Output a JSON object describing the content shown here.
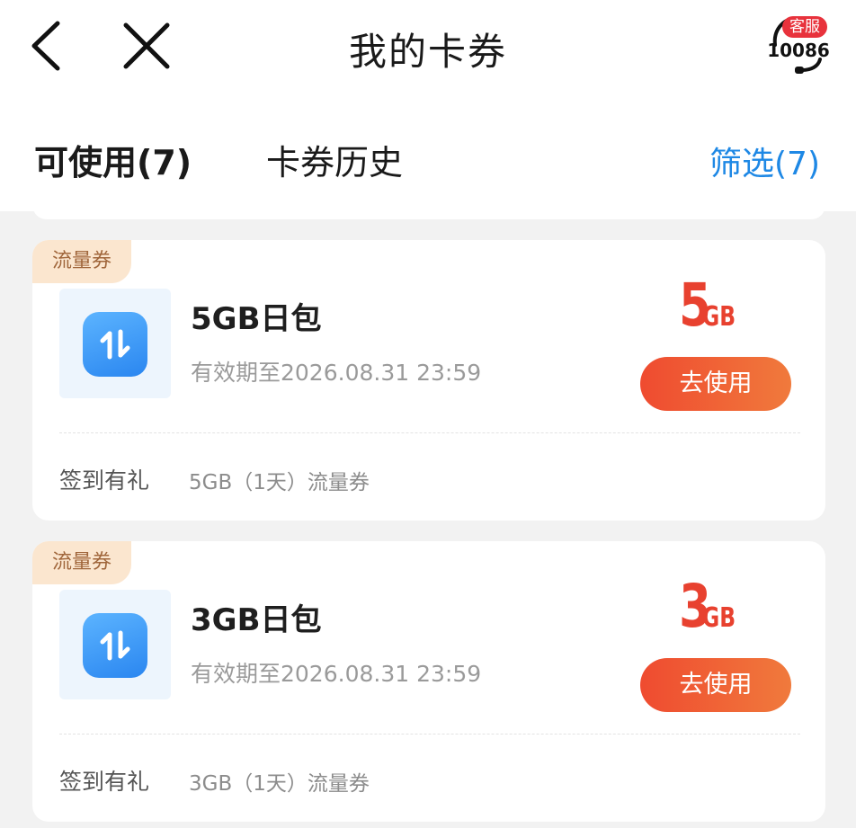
{
  "header": {
    "title": "我的卡券",
    "back_icon": "chevron-left-icon",
    "close_icon": "close-icon",
    "service": {
      "badge": "客服",
      "number": "10086",
      "icon": "headset-icon",
      "badge_color": "#e8323c"
    }
  },
  "tabs": {
    "available_label": "可使用(7)",
    "history_label": "卡券历史",
    "filter_label": "筛选(7)"
  },
  "colors": {
    "accent_blue": "#1e88e5",
    "amount_red": "#e8412f",
    "tag_bg": "#fbe6cf",
    "tag_text": "#a0663b"
  },
  "coupons": [
    {
      "tag": "流量券",
      "title": "5GB日包",
      "expiry": "有效期至2026.08.31 23:59",
      "amount": "5",
      "unit": "GB",
      "button_label": "去使用",
      "source": "签到有礼",
      "description": "5GB（1天）流量券",
      "icon": "data-traffic-icon"
    },
    {
      "tag": "流量券",
      "title": "3GB日包",
      "expiry": "有效期至2026.08.31 23:59",
      "amount": "3",
      "unit": "GB",
      "button_label": "去使用",
      "source": "签到有礼",
      "description": "3GB（1天）流量券",
      "icon": "data-traffic-icon"
    }
  ]
}
